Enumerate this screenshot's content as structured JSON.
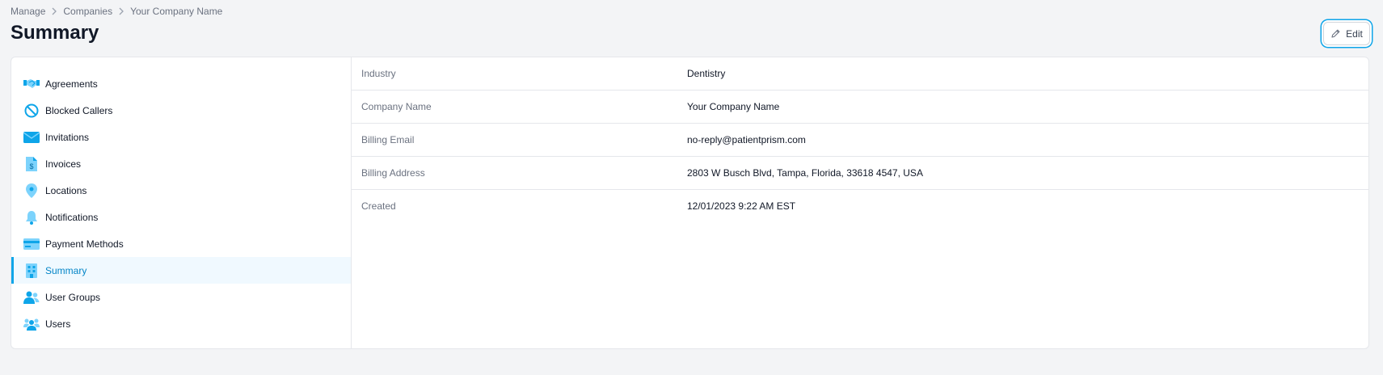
{
  "breadcrumb": {
    "items": [
      "Manage",
      "Companies",
      "Your Company Name"
    ]
  },
  "page": {
    "title": "Summary",
    "edit_label": "Edit"
  },
  "sidebar": {
    "items": [
      {
        "label": "Agreements",
        "icon": "handshake-icon"
      },
      {
        "label": "Blocked Callers",
        "icon": "blocked-icon"
      },
      {
        "label": "Invitations",
        "icon": "envelope-icon"
      },
      {
        "label": "Invoices",
        "icon": "invoice-icon"
      },
      {
        "label": "Locations",
        "icon": "map-pin-icon"
      },
      {
        "label": "Notifications",
        "icon": "bell-icon"
      },
      {
        "label": "Payment Methods",
        "icon": "credit-card-icon"
      },
      {
        "label": "Summary",
        "icon": "building-icon",
        "active": true
      },
      {
        "label": "User Groups",
        "icon": "user-group-icon"
      },
      {
        "label": "Users",
        "icon": "users-icon"
      }
    ]
  },
  "details": {
    "rows": [
      {
        "label": "Industry",
        "value": "Dentistry"
      },
      {
        "label": "Company Name",
        "value": "Your Company Name"
      },
      {
        "label": "Billing Email",
        "value": "no-reply@patientprism.com"
      },
      {
        "label": "Billing Address",
        "value": "2803 W Busch Blvd, Tampa, Florida, 33618 4547, USA"
      },
      {
        "label": "Created",
        "value": "12/01/2023 9:22 AM EST"
      }
    ]
  },
  "colors": {
    "accent": "#0ea5e9",
    "icon_dark": "#0ea5e9",
    "icon_light": "#7dd3fc"
  }
}
